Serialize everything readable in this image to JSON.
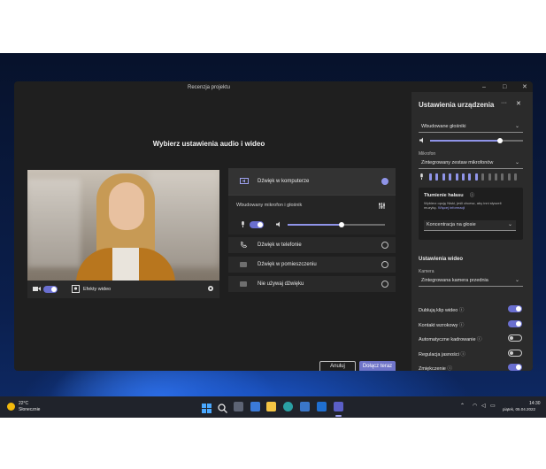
{
  "window": {
    "title": "Recenzja projektu",
    "min": "–",
    "max": "□",
    "close": "✕"
  },
  "main": {
    "heading": "Wybierz ustawienia audio i wideo",
    "video_effects_label": "Efekty wideo",
    "audio_options": [
      {
        "label": "Dźwięk w komputerze",
        "selected": true
      },
      {
        "label": "Dźwięk w telefonie",
        "selected": false
      },
      {
        "label": "Dźwięk w pomieszczeniu",
        "selected": false
      },
      {
        "label": "Nie używaj dźwięku",
        "selected": false
      }
    ],
    "device_summary": "Wbudowany mikrofon i głośnik",
    "speaker_volume": 0.55,
    "cancel_label": "Anuluj",
    "join_label": "Dołącz teraz"
  },
  "device_settings": {
    "title": "Ustawienia urządzenia",
    "more": "···",
    "speaker_value": "Wbudowane głośniki",
    "speaker_volume": 0.75,
    "mic_label": "Mikrofon",
    "mic_value": "Zintegrowany zestaw mikrofonów",
    "mic_level_bars": 8,
    "mic_total_bars": 14,
    "noise": {
      "title": "Tłumienie hałasu",
      "desc": "Wybierz opcję Niski, jeśli chcesz, aby inni słyszeli muzykę.",
      "link": "Więcej informacji",
      "value": "Koncentracja na głosie"
    },
    "video_section": "Ustawienia wideo",
    "camera_label": "Kamera",
    "camera_value": "Zintegrowana kamera przednia",
    "toggles": [
      {
        "label": "Dublują klip wideo",
        "on": true
      },
      {
        "label": "Kontakt wzrokowy",
        "on": true
      },
      {
        "label": "Automatyczne kadrowanie",
        "on": false
      },
      {
        "label": "Regulacja jasności",
        "on": false
      },
      {
        "label": "Zmiękczenie",
        "on": true
      }
    ]
  },
  "taskbar": {
    "temp": "22°C",
    "weather": "Słonecznie",
    "time": "14:30",
    "date": "piątek, 05.04.2022"
  },
  "colors": {
    "accent": "#8f94e8",
    "window_bg": "#1f1f1f",
    "panel_bg": "#2b2b2b"
  }
}
